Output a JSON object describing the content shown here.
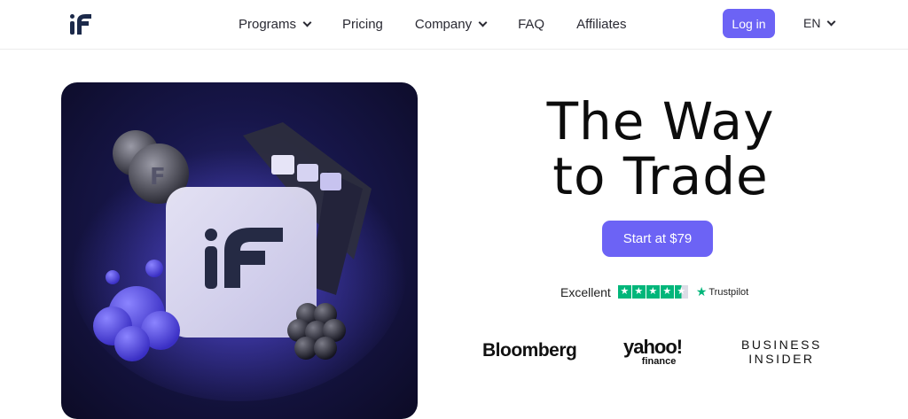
{
  "nav": {
    "items": [
      {
        "label": "Programs",
        "dropdown": true
      },
      {
        "label": "Pricing",
        "dropdown": false
      },
      {
        "label": "Company",
        "dropdown": true
      },
      {
        "label": "FAQ",
        "dropdown": false
      },
      {
        "label": "Affiliates",
        "dropdown": false
      }
    ],
    "login_label": "Log in",
    "language": "EN"
  },
  "hero": {
    "title_line1": "The Way",
    "title_line2": "to Trade",
    "cta_label": "Start at $79"
  },
  "trustpilot": {
    "rating_text": "Excellent",
    "stars": 4.5,
    "brand": "Trustpilot"
  },
  "press": {
    "bloomberg": "Bloomberg",
    "yahoo_main": "yahoo!",
    "yahoo_sub": "finance",
    "bi_line1": "BUSINESS",
    "bi_line2": "INSIDER"
  },
  "colors": {
    "accent": "#6c63f5",
    "trustpilot_green": "#00b67a",
    "hero_bg": "#17164a"
  },
  "icons": [
    "logo-icon",
    "chevron-down-icon",
    "trustpilot-star-icon"
  ]
}
